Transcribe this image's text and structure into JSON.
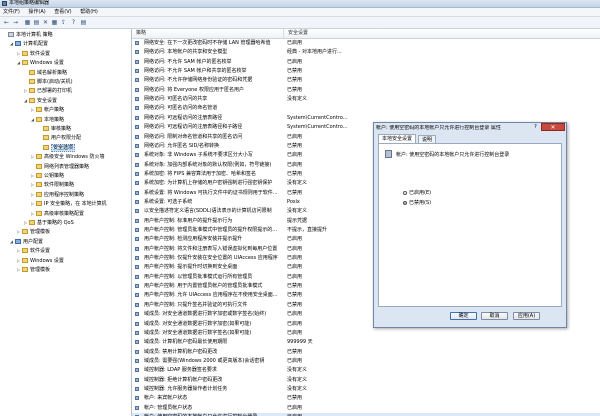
{
  "window": {
    "title": "本地组策略编辑器"
  },
  "menu": [
    "文件(F)",
    "操作(A)",
    "查看(V)",
    "帮助(H)"
  ],
  "toolbar": [
    "←",
    "→",
    "▦",
    "▤",
    "✕",
    "▦",
    "⇪",
    "?",
    "▤"
  ],
  "tree": [
    {
      "label": "本地计算机 策略",
      "level": 0,
      "icon": "gray",
      "exp": ""
    },
    {
      "label": "计算机配置",
      "level": 1,
      "icon": "blue",
      "exp": "◢"
    },
    {
      "label": "软件设置",
      "level": 2,
      "icon": "folder",
      "exp": "▷"
    },
    {
      "label": "Windows 设置",
      "level": 2,
      "icon": "folder",
      "exp": "◢"
    },
    {
      "label": "域名解析策略",
      "level": 3,
      "icon": "folder",
      "exp": ""
    },
    {
      "label": "脚本(启动/关机)",
      "level": 3,
      "icon": "folder",
      "exp": ""
    },
    {
      "label": "已部署的打印机",
      "level": 3,
      "icon": "folder",
      "exp": "▷"
    },
    {
      "label": "安全设置",
      "level": 3,
      "icon": "folder",
      "exp": "◢"
    },
    {
      "label": "帐户策略",
      "level": 4,
      "icon": "folder",
      "exp": "▷"
    },
    {
      "label": "本地策略",
      "level": 4,
      "icon": "folder",
      "exp": "◢"
    },
    {
      "label": "审核策略",
      "level": 5,
      "icon": "folder",
      "exp": ""
    },
    {
      "label": "用户权限分配",
      "level": 5,
      "icon": "folder",
      "exp": ""
    },
    {
      "label": "安全选项",
      "level": 5,
      "icon": "folder",
      "exp": "",
      "selected": true
    },
    {
      "label": "高级安全 Windows 防火墙",
      "level": 4,
      "icon": "folder",
      "exp": "▷"
    },
    {
      "label": "网络列表管理器策略",
      "level": 4,
      "icon": "folder",
      "exp": ""
    },
    {
      "label": "公钥策略",
      "level": 4,
      "icon": "folder",
      "exp": "▷"
    },
    {
      "label": "软件限制策略",
      "level": 4,
      "icon": "folder",
      "exp": "▷"
    },
    {
      "label": "应用程序控制策略",
      "level": 4,
      "icon": "folder",
      "exp": "▷"
    },
    {
      "label": "IP 安全策略，在 本地计算机",
      "level": 4,
      "icon": "folder",
      "exp": "▷"
    },
    {
      "label": "高级审核策略配置",
      "level": 4,
      "icon": "folder",
      "exp": "▷"
    },
    {
      "label": "基于策略的 QoS",
      "level": 3,
      "icon": "folder",
      "exp": "▷"
    },
    {
      "label": "管理模板",
      "level": 2,
      "icon": "folder",
      "exp": "▷"
    },
    {
      "label": "用户配置",
      "level": 1,
      "icon": "blue",
      "exp": "◢"
    },
    {
      "label": "软件设置",
      "level": 2,
      "icon": "folder",
      "exp": "▷"
    },
    {
      "label": "Windows 设置",
      "level": 2,
      "icon": "folder",
      "exp": "▷"
    },
    {
      "label": "管理模板",
      "level": 2,
      "icon": "folder",
      "exp": "▷"
    }
  ],
  "list": {
    "col_policy": "策略",
    "col_setting": "安全设置",
    "rows": [
      {
        "p": "网络安全: 在下一次更改密码时不存储 LAN 管理器哈希值",
        "s": "已启用"
      },
      {
        "p": "网络访问: 本地帐户的共享和安全模型",
        "s": "经典 - 对本地用户进行..."
      },
      {
        "p": "网络访问: 不允许 SAM 帐户的匿名枚举",
        "s": "已启用"
      },
      {
        "p": "网络访问: 不允许 SAM 帐户和共享的匿名枚举",
        "s": "已禁用"
      },
      {
        "p": "网络访问: 不允许存储网络身份验证的密码和凭据",
        "s": "已禁用"
      },
      {
        "p": "网络访问: 将 Everyone 权限应用于匿名用户",
        "s": "已禁用"
      },
      {
        "p": "网络访问: 可匿名访问的共享",
        "s": "没有定义"
      },
      {
        "p": "网络访问: 可匿名访问的命名管道",
        "s": ""
      },
      {
        "p": "网络访问: 可远程访问的注册表路径",
        "s": "System\\CurrentContro..."
      },
      {
        "p": "网络访问: 可远程访问的注册表路径和子路径",
        "s": "System\\CurrentContro..."
      },
      {
        "p": "网络访问: 限制对命名管道和共享的匿名访问",
        "s": "已启用"
      },
      {
        "p": "网络访问: 允许匿名 SID/名称转换",
        "s": "已禁用"
      },
      {
        "p": "系统对象: 非 Windows 子系统不要求区分大小写",
        "s": "已启用"
      },
      {
        "p": "系统对象: 加强内部系统对象的默认权限(例如，符号链接)",
        "s": "已启用"
      },
      {
        "p": "系统加密: 将 FIPS 兼容算法用于加密、哈希和签名",
        "s": "已禁用"
      },
      {
        "p": "系统加密: 为计算机上存储的用户密钥强制进行强密钥保护",
        "s": "没有定义"
      },
      {
        "p": "系统设置: 将 Windows 可执行文件中的证书规则用于软件...",
        "s": "已禁用"
      },
      {
        "p": "系统设置: 可选子系统",
        "s": "Posix"
      },
      {
        "p": "以安全描述符定义语言(SDDL)语法表示的计算机访问限制",
        "s": "没有定义"
      },
      {
        "p": "用户帐户控制: 标准用户的提升提示行为",
        "s": "提示凭据"
      },
      {
        "p": "用户帐户控制: 管理员批准模式中管理员的提升权限提示的...",
        "s": "不提示，直接提升"
      },
      {
        "p": "用户帐户控制: 检测应用程序安装并提示提升",
        "s": "已启用"
      },
      {
        "p": "用户帐户控制: 将文件和注册表写入错误虚拟化到每用户位置",
        "s": "已启用"
      },
      {
        "p": "用户帐户控制: 仅提升安装在安全位置的 UIAccess 应用程序",
        "s": "已启用"
      },
      {
        "p": "用户帐户控制: 提示提升时切换到安全桌面",
        "s": "已启用"
      },
      {
        "p": "用户帐户控制: 以管理员批准模式运行所有管理员",
        "s": "已启用"
      },
      {
        "p": "用户帐户控制: 用于内置管理员帐户的管理员批准模式",
        "s": "已禁用"
      },
      {
        "p": "用户帐户控制: 允许 UIAccess 应用程序在不使用安全桌面...",
        "s": "已禁用"
      },
      {
        "p": "用户帐户控制: 只提升签名并验证的可执行文件",
        "s": "已禁用"
      },
      {
        "p": "域成员: 对安全通道数据进行数字加密或数字签名(始终)",
        "s": "已启用"
      },
      {
        "p": "域成员: 对安全通道数据进行数字加密(如果可能)",
        "s": "已启用"
      },
      {
        "p": "域成员: 对安全通道数据进行数字签名(如果可能)",
        "s": "已启用"
      },
      {
        "p": "域成员: 计算机帐户密码最长使用期限",
        "s": "999999 天"
      },
      {
        "p": "域成员: 禁用计算机帐户密码更改",
        "s": "已禁用"
      },
      {
        "p": "域成员: 需要强(Windows 2000 或更高版本)会话密钥",
        "s": "已启用"
      },
      {
        "p": "域控制器: LDAP 服务器签名要求",
        "s": "没有定义"
      },
      {
        "p": "域控制器: 拒绝计算机帐户密码更改",
        "s": "没有定义"
      },
      {
        "p": "域控制器: 允许服务器操作者计划任务",
        "s": "没有定义"
      },
      {
        "p": "帐户: 来宾帐户状态",
        "s": "已禁用"
      },
      {
        "p": "帐户: 管理员帐户状态",
        "s": "已启用"
      },
      {
        "p": "帐户: 使用空密码的本地帐户只允许进行控制台登录",
        "s": "已启用",
        "hl": true
      }
    ]
  },
  "dialog": {
    "title": "帐户: 使用空密码的本地帐户只允许进行控制台登录 属性",
    "help": "?",
    "close": "✕",
    "tabs": [
      "本地安全设置",
      "说明"
    ],
    "policy_name": "帐户: 使用空密码的本地帐户只允许进行控制台登录",
    "options": [
      {
        "label": "已启用(E)",
        "checked": false
      },
      {
        "label": "已禁用(S)",
        "checked": true
      }
    ],
    "buttons": {
      "ok": "确定",
      "cancel": "取消",
      "apply": "应用(A)"
    }
  }
}
